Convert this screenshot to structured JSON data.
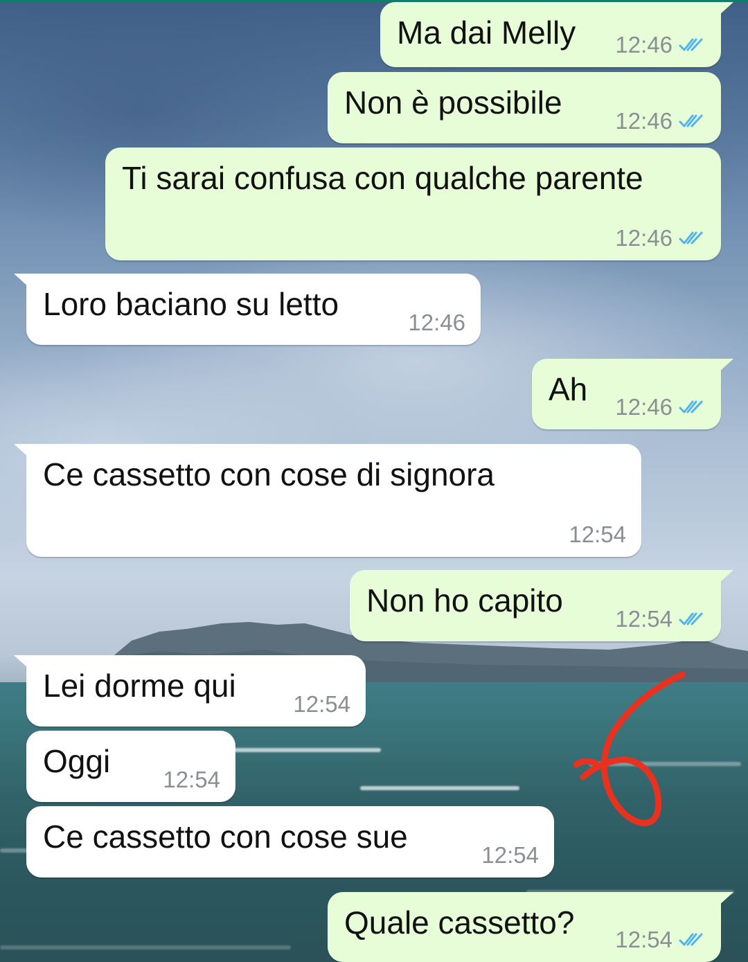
{
  "theme": {
    "outgoing_bubble": "#e7fdd8",
    "incoming_bubble": "#ffffff",
    "read_tick_color": "#4fb3f0",
    "annotation_color": "#e8321f"
  },
  "messages": [
    {
      "direction": "out",
      "text": "Ma dai Melly",
      "time": "12:46",
      "status": "read"
    },
    {
      "direction": "out",
      "text": "Non è possibile",
      "time": "12:46",
      "status": "read"
    },
    {
      "direction": "out",
      "text": "Ti sarai confusa con qualche parente",
      "time": "12:46",
      "status": "read"
    },
    {
      "direction": "in",
      "text": "Loro baciano su letto",
      "time": "12:46"
    },
    {
      "direction": "out",
      "text": "Ah",
      "time": "12:46",
      "status": "read"
    },
    {
      "direction": "in",
      "text": "Ce cassetto con cose di signora",
      "time": "12:54"
    },
    {
      "direction": "out",
      "text": "Non ho capito",
      "time": "12:54",
      "status": "read"
    },
    {
      "direction": "in",
      "text": "Lei dorme qui",
      "time": "12:54"
    },
    {
      "direction": "in",
      "text": "Oggi",
      "time": "12:54"
    },
    {
      "direction": "in",
      "text": "Ce cassetto con cose sue",
      "time": "12:54"
    },
    {
      "direction": "out",
      "text": "Quale cassetto?",
      "time": "12:54",
      "status": "read"
    }
  ],
  "icons": {
    "read_receipt": "double-check-icon",
    "annotation": "hand-drawn-six-mark"
  }
}
